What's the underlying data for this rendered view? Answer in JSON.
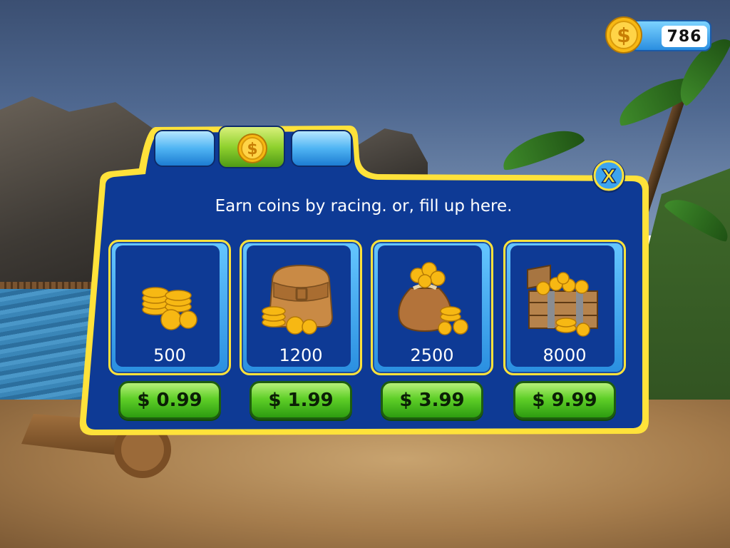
{
  "hud": {
    "coin_balance": "786"
  },
  "shop": {
    "headline": "Earn coins by racing. or, fill up here.",
    "tabs": [
      {
        "id": "left",
        "icon": "blank",
        "active": false
      },
      {
        "id": "coins",
        "icon": "dollar-coin-icon",
        "active": true
      },
      {
        "id": "right",
        "icon": "blank",
        "active": false
      }
    ],
    "close_label": "X",
    "packs": [
      {
        "amount": "500",
        "price": "$ 0.99",
        "art": "coin-stack-icon"
      },
      {
        "amount": "1200",
        "price": "$ 1.99",
        "art": "coin-satchel-icon"
      },
      {
        "amount": "2500",
        "price": "$ 3.99",
        "art": "coin-sack-icon"
      },
      {
        "amount": "8000",
        "price": "$ 9.99",
        "art": "treasure-chest-icon"
      }
    ]
  },
  "colors": {
    "dialog_fill": "#0e3a95",
    "dialog_border": "#ffe23a",
    "price_button": "#5fcf28",
    "coin_gold": "#f7b813"
  }
}
